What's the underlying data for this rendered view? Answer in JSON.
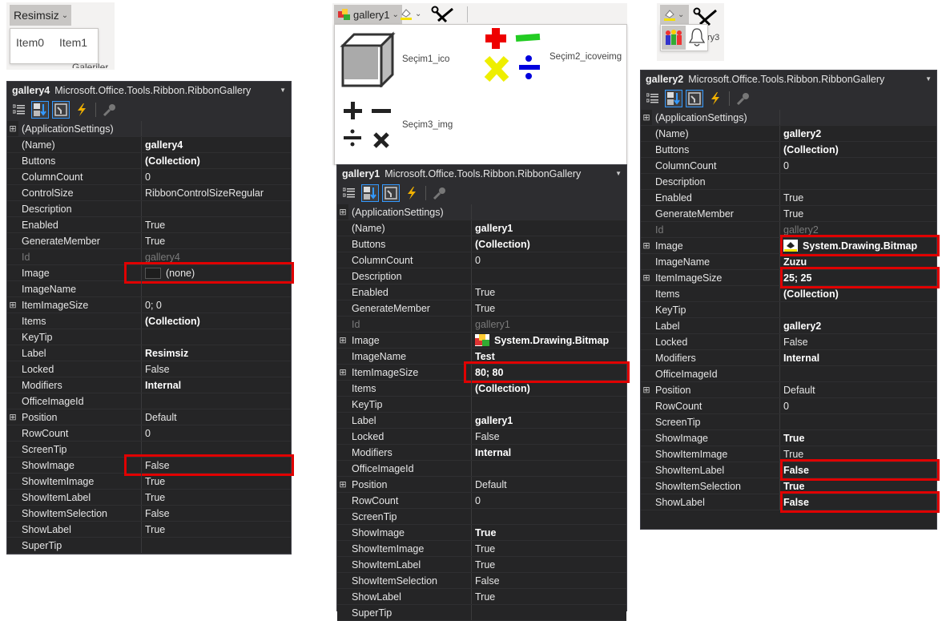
{
  "snip_left": {
    "dropdown_label": "Resimsiz",
    "items": [
      "Item0",
      "Item1"
    ],
    "group_label": "Galeriler"
  },
  "snip_middle": {
    "dropdown_label": "gallery1",
    "items": [
      {
        "label": "Seçim1_ico",
        "icon": "cube-icon"
      },
      {
        "label": "Seçim2_icoveimg",
        "icon": "colored-math-ops-icon"
      },
      {
        "label": "Seçim3_img",
        "icon": "math-ops-icon"
      }
    ]
  },
  "snip_right": {
    "partial_label": "ry3",
    "items": [
      {
        "icon": "people-icon"
      },
      {
        "icon": "bell-icon"
      }
    ]
  },
  "grids": {
    "gallery4": {
      "object": "gallery4",
      "type": "Microsoft.Office.Tools.Ribbon.RibbonGallery",
      "rows": [
        {
          "name": "(ApplicationSettings)",
          "value": "",
          "expand": true,
          "category": true
        },
        {
          "name": "(Name)",
          "value": "gallery4",
          "bold": true
        },
        {
          "name": "Buttons",
          "value": "(Collection)",
          "bold": true
        },
        {
          "name": "ColumnCount",
          "value": "0"
        },
        {
          "name": "ControlSize",
          "value": "RibbonControlSizeRegular"
        },
        {
          "name": "Description",
          "value": ""
        },
        {
          "name": "Enabled",
          "value": "True"
        },
        {
          "name": "GenerateMember",
          "value": "True"
        },
        {
          "name": "Id",
          "value": "gallery4",
          "dim": true
        },
        {
          "name": "Image",
          "value": "(none)",
          "swatch": true,
          "highlight": true
        },
        {
          "name": "ImageName",
          "value": ""
        },
        {
          "name": "ItemImageSize",
          "value": "0; 0",
          "expand": true
        },
        {
          "name": "Items",
          "value": "(Collection)",
          "bold": true
        },
        {
          "name": "KeyTip",
          "value": ""
        },
        {
          "name": "Label",
          "value": "Resimsiz",
          "bold": true
        },
        {
          "name": "Locked",
          "value": "False"
        },
        {
          "name": "Modifiers",
          "value": "Internal",
          "bold": true
        },
        {
          "name": "OfficeImageId",
          "value": ""
        },
        {
          "name": "Position",
          "value": "Default",
          "expand": true
        },
        {
          "name": "RowCount",
          "value": "0"
        },
        {
          "name": "ScreenTip",
          "value": ""
        },
        {
          "name": "ShowImage",
          "value": "False",
          "highlight": true
        },
        {
          "name": "ShowItemImage",
          "value": "True"
        },
        {
          "name": "ShowItemLabel",
          "value": "True"
        },
        {
          "name": "ShowItemSelection",
          "value": "False"
        },
        {
          "name": "ShowLabel",
          "value": "True"
        },
        {
          "name": "SuperTip",
          "value": ""
        }
      ]
    },
    "gallery1": {
      "object": "gallery1",
      "type": "Microsoft.Office.Tools.Ribbon.RibbonGallery",
      "rows": [
        {
          "name": "(ApplicationSettings)",
          "value": "",
          "expand": true,
          "category": true
        },
        {
          "name": "(Name)",
          "value": "gallery1",
          "bold": true
        },
        {
          "name": "Buttons",
          "value": "(Collection)",
          "bold": true
        },
        {
          "name": "ColumnCount",
          "value": "0"
        },
        {
          "name": "Description",
          "value": ""
        },
        {
          "name": "Enabled",
          "value": "True"
        },
        {
          "name": "GenerateMember",
          "value": "True"
        },
        {
          "name": "Id",
          "value": "gallery1",
          "dim": true
        },
        {
          "name": "Image",
          "value": "System.Drawing.Bitmap",
          "bold": true,
          "expand": true,
          "bitmap": "abc"
        },
        {
          "name": "ImageName",
          "value": "Test",
          "bold": true
        },
        {
          "name": "ItemImageSize",
          "value": "80; 80",
          "bold": true,
          "expand": true,
          "highlight": true
        },
        {
          "name": "Items",
          "value": "(Collection)",
          "bold": true
        },
        {
          "name": "KeyTip",
          "value": ""
        },
        {
          "name": "Label",
          "value": "gallery1",
          "bold": true
        },
        {
          "name": "Locked",
          "value": "False"
        },
        {
          "name": "Modifiers",
          "value": "Internal",
          "bold": true
        },
        {
          "name": "OfficeImageId",
          "value": ""
        },
        {
          "name": "Position",
          "value": "Default",
          "expand": true
        },
        {
          "name": "RowCount",
          "value": "0"
        },
        {
          "name": "ScreenTip",
          "value": ""
        },
        {
          "name": "ShowImage",
          "value": "True",
          "bold": true
        },
        {
          "name": "ShowItemImage",
          "value": "True"
        },
        {
          "name": "ShowItemLabel",
          "value": "True"
        },
        {
          "name": "ShowItemSelection",
          "value": "False"
        },
        {
          "name": "ShowLabel",
          "value": "True"
        },
        {
          "name": "SuperTip",
          "value": ""
        }
      ]
    },
    "gallery2": {
      "object": "gallery2",
      "type": "Microsoft.Office.Tools.Ribbon.RibbonGallery",
      "rows": [
        {
          "name": "(ApplicationSettings)",
          "value": "",
          "expand": true,
          "category": true
        },
        {
          "name": "(Name)",
          "value": "gallery2",
          "bold": true
        },
        {
          "name": "Buttons",
          "value": "(Collection)",
          "bold": true
        },
        {
          "name": "ColumnCount",
          "value": "0"
        },
        {
          "name": "Description",
          "value": ""
        },
        {
          "name": "Enabled",
          "value": "True"
        },
        {
          "name": "GenerateMember",
          "value": "True"
        },
        {
          "name": "Id",
          "value": "gallery2",
          "dim": true
        },
        {
          "name": "Image",
          "value": "System.Drawing.Bitmap",
          "bold": true,
          "expand": true,
          "bitmap": "paint",
          "highlight": true
        },
        {
          "name": "ImageName",
          "value": "Zuzu",
          "bold": true
        },
        {
          "name": "ItemImageSize",
          "value": "25; 25",
          "bold": true,
          "expand": true,
          "highlight": true
        },
        {
          "name": "Items",
          "value": "(Collection)",
          "bold": true
        },
        {
          "name": "KeyTip",
          "value": ""
        },
        {
          "name": "Label",
          "value": "gallery2",
          "bold": true
        },
        {
          "name": "Locked",
          "value": "False"
        },
        {
          "name": "Modifiers",
          "value": "Internal",
          "bold": true
        },
        {
          "name": "OfficeImageId",
          "value": ""
        },
        {
          "name": "Position",
          "value": "Default",
          "expand": true
        },
        {
          "name": "RowCount",
          "value": "0"
        },
        {
          "name": "ScreenTip",
          "value": ""
        },
        {
          "name": "ShowImage",
          "value": "True",
          "bold": true
        },
        {
          "name": "ShowItemImage",
          "value": "True"
        },
        {
          "name": "ShowItemLabel",
          "value": "False",
          "bold": true,
          "highlight": true
        },
        {
          "name": "ShowItemSelection",
          "value": "True",
          "bold": true
        },
        {
          "name": "ShowLabel",
          "value": "False",
          "bold": true,
          "highlight": true
        }
      ]
    }
  },
  "toolbar_icons": [
    "categorized-icon",
    "alphabetical-icon",
    "properties-icon",
    "events-icon",
    "property-pages-icon"
  ],
  "highlight_color": "#e00000"
}
